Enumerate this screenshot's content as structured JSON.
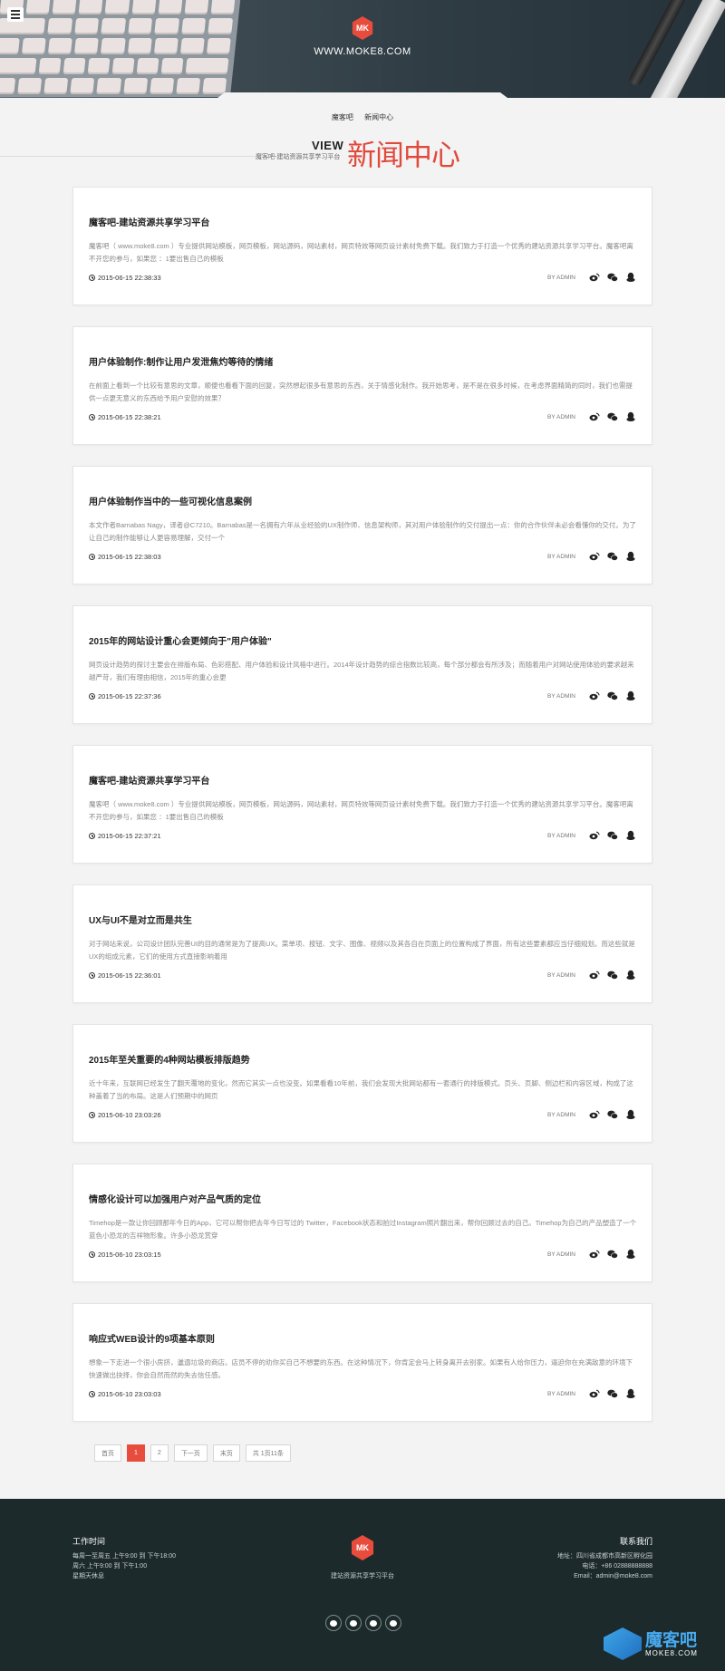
{
  "hero": {
    "logo_text": "MK",
    "site_url": "WWW.MOKE8.COM"
  },
  "breadcrumb": [
    "魔客吧",
    "新闻中心"
  ],
  "section": {
    "view_label": "VIEW",
    "view_sub": "魔客吧-建站资源共享学习平台",
    "title": "新闻中心"
  },
  "articles": [
    {
      "title": "魔客吧-建站资源共享学习平台",
      "excerpt": "魔客吧（ www.moke8.com ）专业提供网站模板，网页模板，网站源码，网站素材，网页特效等网页设计素材免费下载。我们致力于打造一个优秀的建站资源共享学习平台。魔客吧离不开您的参与，如果您 ：1要出售自己的模板",
      "date": "2015-06-15 22:38:33",
      "author": "BY ADMIN"
    },
    {
      "title": "用户体验制作:制作让用户发泄焦灼等待的情绪",
      "excerpt": "在前面上看到一个比较有意思的文章，顺便也看看下面的回复，突然想起很多有意思的东西，关于情感化制作。我开始思考，是不是在很多时候，在考虑界面精简的同时，我们也需提供一点更无意义的东西给予用户安慰的效果？",
      "date": "2015-06-15 22:38:21",
      "author": "BY ADMIN"
    },
    {
      "title": "用户体验制作当中的一些可视化信息案例",
      "excerpt": "本文作者Barnabas Nagy，译者@C7210。Barnabas是一名拥有六年从业经验的UX制作师、信息架构师，其对用户体验制作的交付提出一点：你的合作伙伴未必会看懂你的交付。为了让自己的制作能够让人更容易理解，交付一个",
      "date": "2015-06-15 22:38:03",
      "author": "BY ADMIN"
    },
    {
      "title": "2015年的网站设计重心会更倾向于\"用户体验\"",
      "excerpt": "网页设计趋势的探讨主要会在排版布局、色彩搭配、用户体验和设计风格中进行。2014年设计趋势的综合指数比较高，每个部分都会有所涉及；而随着用户对网站使用体验的要求越来越严苛，我们有理由相信，2015年的重心会更",
      "date": "2015-06-15 22:37:36",
      "author": "BY ADMIN"
    },
    {
      "title": "魔客吧-建站资源共享学习平台",
      "excerpt": "魔客吧（ www.moke8.com ）专业提供网站模板，网页模板，网站源码，网站素材，网页特效等网页设计素材免费下载。我们致力于打造一个优秀的建站资源共享学习平台。魔客吧离不开您的参与，如果您 ：1要出售自己的模板",
      "date": "2015-06-15 22:37:21",
      "author": "BY ADMIN"
    },
    {
      "title": "UX与UI不是对立而是共生",
      "excerpt": "对于网站来说，公司设计团队完善UI的目的通常是为了提高UX。菜单项、按钮、文字、图像、视频以及其各自在页面上的位置构成了界面，所有这些要素都应当仔细规划。而这些就是UX的组成元素，它们的使用方式直接影响着用",
      "date": "2015-06-15 22:36:01",
      "author": "BY ADMIN"
    },
    {
      "title": "2015年至关重要的4种网站模板排版趋势",
      "excerpt": "近十年来，互联网已经发生了翻天覆地的变化，然而它其实一点也没变。如果看看10年前，我们会发现大批网站都有一套通行的排版模式。页头、页脚、侧边栏和内容区域，构成了这种盖着了当的布局。这是人们预期中的网页",
      "date": "2015-06-10 23:03:26",
      "author": "BY ADMIN"
    },
    {
      "title": "情感化设计可以加强用户对产品气质的定位",
      "excerpt": "Timehop是一款让你回顾那年今日的App，它可以帮你把去年今日写过的 Twitter，Facebook状态和拍过Instagram照片翻出来，帮你回顾过去的自己。Timehop为自己的产品塑造了一个蓝色小恐龙的吉祥物形象。许多小恐龙赏穿",
      "date": "2015-06-10 23:03:15",
      "author": "BY ADMIN"
    },
    {
      "title": "响应式WEB设计的9项基本原则",
      "excerpt": "想象一下走进一个很小房挤，邋遢垃圾的商店。店员不停的劝你买自己不想要的东西。在这种情况下，你肯定会马上转身离开去别家。如果有人给你压力，逼迫你在充满敌意的环境下快速做出抉择，你会自然而然的失去信任感。",
      "date": "2015-06-10 23:03:03",
      "author": "BY ADMIN"
    }
  ],
  "pagination": [
    "首页",
    "1",
    "2",
    "下一页",
    "末页",
    "共 1页11条"
  ],
  "footer": {
    "hours_heading": "工作时间",
    "hours_lines": [
      "每周一至周五 上午9:00 到 下午18:00",
      "周六 上午9:00 到 下午1:00",
      "星期天休息"
    ],
    "logo_text": "MK",
    "tagline": "建站资源共享学习平台",
    "contact_heading": "联系我们",
    "contact_lines": [
      "地址：四川省成都市高新区孵化园",
      "电话：+86 02888888888",
      "Email：admin@moke8.com"
    ]
  },
  "watermark": {
    "text": "魔客吧",
    "sub": "MOKE8.COM"
  },
  "colors": {
    "accent": "#e84c3d",
    "footer_bg": "#1c2a2c"
  }
}
